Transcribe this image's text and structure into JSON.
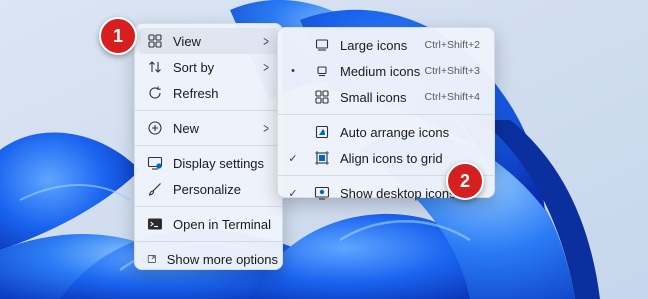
{
  "context_menu": {
    "items": [
      {
        "label": "View",
        "icon": "grid-icon",
        "has_submenu": true
      },
      {
        "label": "Sort by",
        "icon": "sort-icon",
        "has_submenu": true
      },
      {
        "label": "Refresh",
        "icon": "refresh-icon",
        "has_submenu": false
      },
      {
        "label": "New",
        "icon": "plus-circle-icon",
        "has_submenu": true
      },
      {
        "label": "Display settings",
        "icon": "display-icon",
        "has_submenu": false
      },
      {
        "label": "Personalize",
        "icon": "brush-icon",
        "has_submenu": false
      },
      {
        "label": "Open in Terminal",
        "icon": "terminal-icon",
        "has_submenu": false
      },
      {
        "label": "Show more options",
        "icon": "expand-icon",
        "has_submenu": false
      }
    ]
  },
  "view_submenu": {
    "items": [
      {
        "label": "Large icons",
        "shortcut": "Ctrl+Shift+2",
        "mark": ""
      },
      {
        "label": "Medium icons",
        "shortcut": "Ctrl+Shift+3",
        "mark": "•"
      },
      {
        "label": "Small icons",
        "shortcut": "Ctrl+Shift+4",
        "mark": ""
      },
      {
        "label": "Auto arrange icons",
        "shortcut": "",
        "mark": ""
      },
      {
        "label": "Align icons to grid",
        "shortcut": "",
        "mark": "✓"
      },
      {
        "label": "Show desktop icons",
        "shortcut": "",
        "mark": "✓"
      }
    ]
  },
  "callouts": {
    "badge_1": "1",
    "badge_2": "2"
  },
  "colors": {
    "accent": "#0067c0",
    "badge": "#d61f1f",
    "wallpaper_light": "#cfdcef",
    "wallpaper_blue": "#1463e6"
  }
}
